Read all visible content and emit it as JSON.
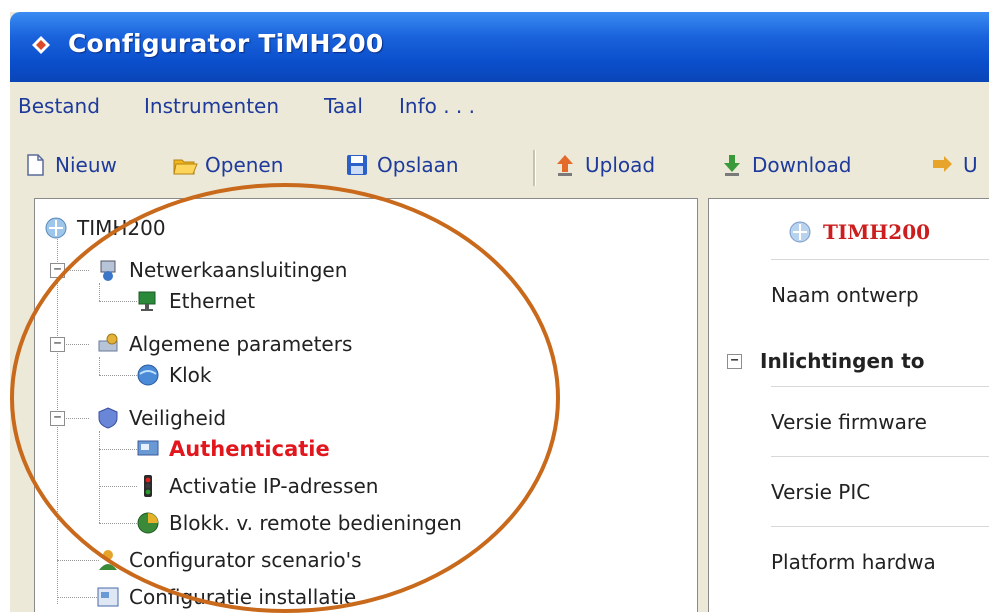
{
  "window": {
    "title": "Configurator TiMH200"
  },
  "menu": {
    "items": [
      "Bestand",
      "Instrumenten",
      "Taal",
      "Info . . ."
    ]
  },
  "toolbar": {
    "new": "Nieuw",
    "open": "Openen",
    "save": "Opslaan",
    "upload": "Upload",
    "download": "Download",
    "partial": "U"
  },
  "tree": {
    "root": "TIMH200",
    "net": "Netwerkaansluitingen",
    "ethernet": "Ethernet",
    "general": "Algemene parameters",
    "clock": "Klok",
    "security": "Veiligheid",
    "auth": "Authenticatie",
    "ip": "Activatie IP-adressen",
    "remote": "Blokk. v. remote bedieningen",
    "scenarios": "Configurator scenario's",
    "install": "Configuratie installatie"
  },
  "details": {
    "header": "TIMH200",
    "design_name": "Naam ontwerp",
    "section": "Inlichtingen to",
    "firmware": "Versie firmware",
    "pic": "Versie PIC",
    "platform": "Platform hardwa"
  },
  "colors": {
    "titlebar": "#0b4fcc",
    "selected": "#e2171d",
    "annotation": "#c8691b"
  },
  "icons": [
    "configurator-logo-icon",
    "new-document-icon",
    "folder-open-icon",
    "floppy-disk-icon",
    "upload-icon",
    "download-icon",
    "network-icon",
    "ethernet-icon",
    "settings-icon",
    "globe-icon",
    "shield-icon",
    "monitor-icon",
    "traffic-light-icon",
    "remote-globe-icon",
    "users-icon",
    "installation-icon"
  ]
}
